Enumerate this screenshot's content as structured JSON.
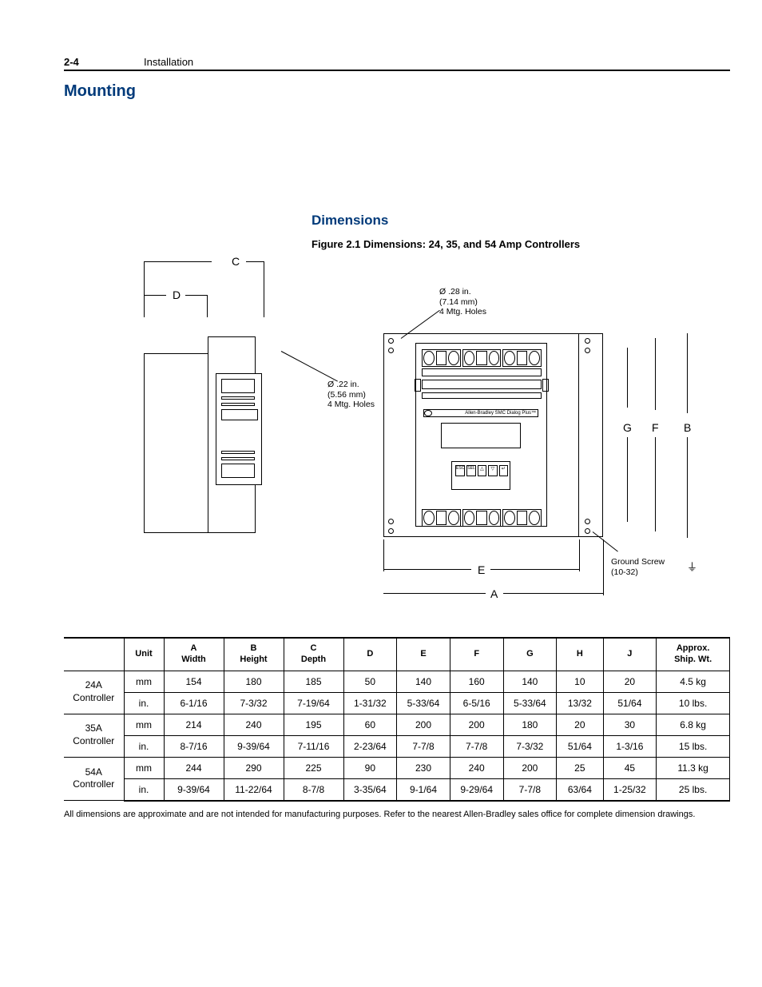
{
  "header": {
    "page_num": "2-4",
    "chapter": "Installation"
  },
  "h1": "Mounting",
  "h2": "Dimensions",
  "fig_caption": "Figure 2.1   Dimensions:  24, 35, and 54 Amp Controllers",
  "diagram": {
    "labels": {
      "A": "A",
      "B": "B",
      "C": "C",
      "D": "D",
      "E": "E",
      "F": "F",
      "G": "G"
    },
    "note_top": {
      "l1": "Ø .28 in.",
      "l2": "(7.14 mm)",
      "l3": "4 Mtg. Holes"
    },
    "note_side": {
      "l1": "Ø .22 in.",
      "l2": "(5.56 mm)",
      "l3": "4 Mtg. Holes"
    },
    "device_label": "Allen-Bradley  SMC Dialog Plus™",
    "ground": {
      "l1": "Ground Screw",
      "l2": "(10-32)"
    }
  },
  "table": {
    "headers": {
      "unit": "Unit",
      "a": {
        "l1": "A",
        "l2": "Width"
      },
      "b": {
        "l1": "B",
        "l2": "Height"
      },
      "c": {
        "l1": "C",
        "l2": "Depth"
      },
      "d": "D",
      "e": "E",
      "f": "F",
      "g": "G",
      "h": "H",
      "j": "J",
      "wt": {
        "l1": "Approx.",
        "l2": "Ship. Wt."
      }
    },
    "rows": [
      {
        "model": "24A Controller",
        "mm": {
          "unit": "mm",
          "a": "154",
          "b": "180",
          "c": "185",
          "d": "50",
          "e": "140",
          "f": "160",
          "g": "140",
          "h": "10",
          "j": "20",
          "wt": "4.5 kg"
        },
        "in": {
          "unit": "in.",
          "a": "6-1/16",
          "b": "7-3/32",
          "c": "7-19/64",
          "d": "1-31/32",
          "e": "5-33/64",
          "f": "6-5/16",
          "g": "5-33/64",
          "h": "13/32",
          "j": "51/64",
          "wt": "10 lbs."
        }
      },
      {
        "model": "35A Controller",
        "mm": {
          "unit": "mm",
          "a": "214",
          "b": "240",
          "c": "195",
          "d": "60",
          "e": "200",
          "f": "200",
          "g": "180",
          "h": "20",
          "j": "30",
          "wt": "6.8 kg"
        },
        "in": {
          "unit": "in.",
          "a": "8-7/16",
          "b": "9-39/64",
          "c": "7-11/16",
          "d": "2-23/64",
          "e": "7-7/8",
          "f": "7-7/8",
          "g": "7-3/32",
          "h": "51/64",
          "j": "1-3/16",
          "wt": "15 lbs."
        }
      },
      {
        "model": "54A Controller",
        "mm": {
          "unit": "mm",
          "a": "244",
          "b": "290",
          "c": "225",
          "d": "90",
          "e": "230",
          "f": "240",
          "g": "200",
          "h": "25",
          "j": "45",
          "wt": "11.3 kg"
        },
        "in": {
          "unit": "in.",
          "a": "9-39/64",
          "b": "11-22/64",
          "c": "8-7/8",
          "d": "3-35/64",
          "e": "9-1/64",
          "f": "9-29/64",
          "g": "7-7/8",
          "h": "63/64",
          "j": "1-25/32",
          "wt": "25 lbs."
        }
      }
    ]
  },
  "footnote": "All dimensions are approximate and are not intended for manufacturing purposes.  Refer to the nearest Allen-Bradley sales office for complete dimension drawings."
}
